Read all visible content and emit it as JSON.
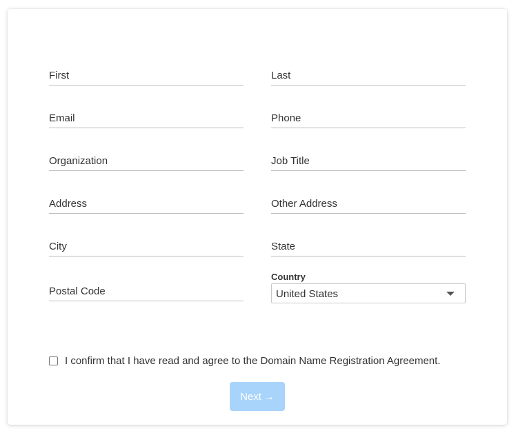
{
  "form": {
    "first": {
      "placeholder": "First",
      "value": ""
    },
    "last": {
      "placeholder": "Last",
      "value": ""
    },
    "email": {
      "placeholder": "Email",
      "value": ""
    },
    "phone": {
      "placeholder": "Phone",
      "value": ""
    },
    "organization": {
      "placeholder": "Organization",
      "value": ""
    },
    "job_title": {
      "placeholder": "Job Title",
      "value": ""
    },
    "address": {
      "placeholder": "Address",
      "value": ""
    },
    "other_address": {
      "placeholder": "Other Address",
      "value": ""
    },
    "city": {
      "placeholder": "City",
      "value": ""
    },
    "state": {
      "placeholder": "State",
      "value": ""
    },
    "postal_code": {
      "placeholder": "Postal Code",
      "value": ""
    },
    "country": {
      "label": "Country",
      "selected": "United States"
    }
  },
  "agreement": {
    "checked": false,
    "text": "I confirm that I have read and agree to the Domain Name Registration Agreement."
  },
  "actions": {
    "next_label": "Next",
    "next_icon": "arrow-right-icon",
    "next_arrow_glyph": "→",
    "next_color": "#a8d4fb"
  }
}
